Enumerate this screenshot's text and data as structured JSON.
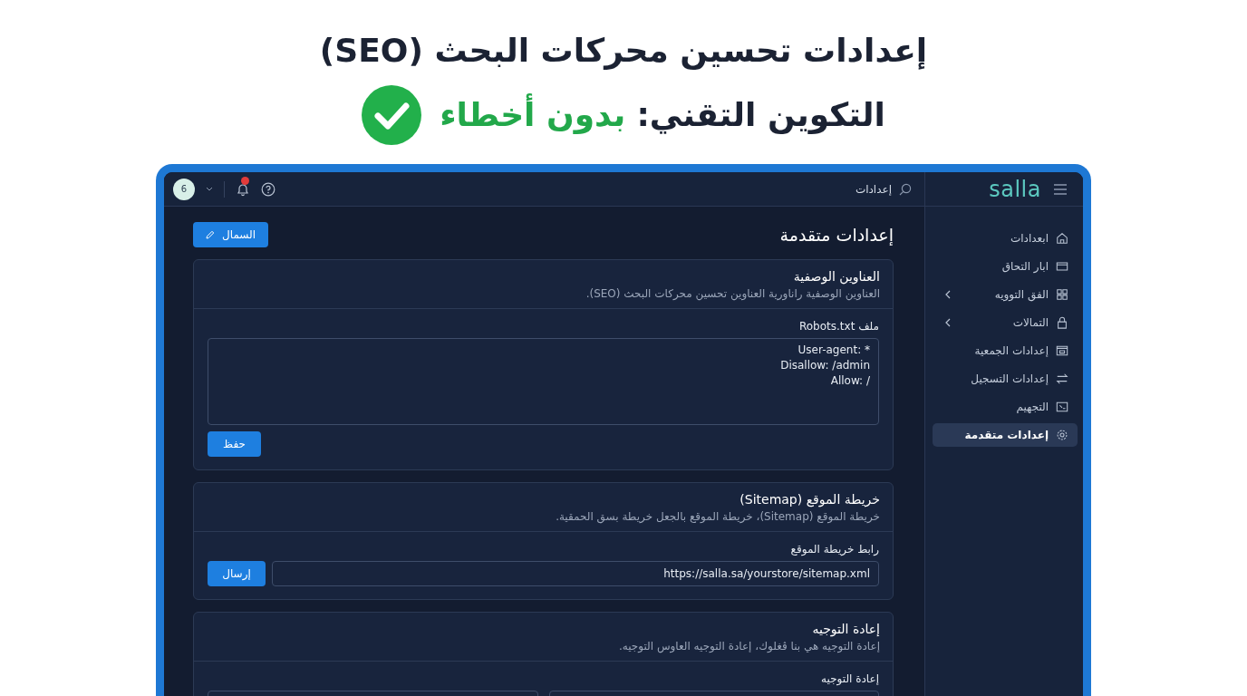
{
  "heading": {
    "title": "إعدادات تحسين محركات البحث (SEO)",
    "subtitle_label": "التكوين التقني:",
    "subtitle_status": "بدون أخطاء"
  },
  "app": {
    "logo": "salla",
    "search_value": "إعدادات",
    "avatar_initial": "6",
    "sidebar": {
      "items": [
        {
          "label": "ابعدادات",
          "selected": false,
          "expandable": false
        },
        {
          "label": "ابار التحاق",
          "selected": false,
          "expandable": false
        },
        {
          "label": "الفق التوويه",
          "selected": false,
          "expandable": true
        },
        {
          "label": "التمالات",
          "selected": false,
          "expandable": true
        },
        {
          "label": "إعدادات الجمعية",
          "selected": false,
          "expandable": false
        },
        {
          "label": "إعدادات التسجيل",
          "selected": false,
          "expandable": false
        },
        {
          "label": "التجهيم",
          "selected": false,
          "expandable": false
        },
        {
          "label": "إعدادات متقدمة",
          "selected": true,
          "expandable": false
        }
      ]
    },
    "page_title": "إعدادات متقدمة",
    "edit_button": "السمال",
    "cards": [
      {
        "kind": "textarea",
        "title": "العناوين الوصفية",
        "description": "العناوين الوصفية راناورية العناوين تحسين محركات البحث (SEO).",
        "field_label": "ملف Robots.txt",
        "value": "User-agent: *\nDisallow: /admin\nAllow: /",
        "button": "حفظ"
      },
      {
        "kind": "url",
        "title": "خريطة الموقع (Sitemap)",
        "description": "خريطة الموقع (Sitemap)، خريطة الموقع بالجعل خريطة بسق الحمقية.",
        "field_label": "رابط خريطة الموقع",
        "value": "https://salla.sa/yourstore/sitemap.xml",
        "button": "إرسال"
      },
      {
        "kind": "redirect",
        "title": "إعادة التوجيه",
        "description": "إعادة التوجيه هي بنا ڤغلوك، إعادة التوجيه العاوس التوجيه.",
        "field_label": "إعادة التوجيه"
      }
    ]
  }
}
